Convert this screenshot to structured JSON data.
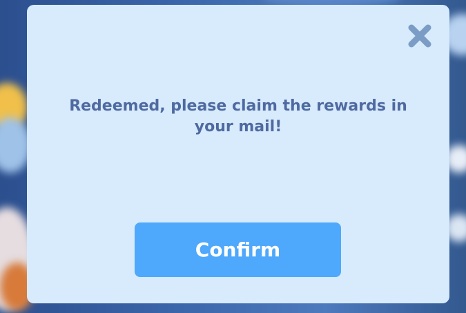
{
  "dialog": {
    "message": "Redeemed, please claim the rewards in your mail!",
    "confirm_label": "Confirm",
    "close_icon": "close-icon"
  },
  "colors": {
    "dialog_background": "#d7ebfd",
    "message_text": "#4f6aa0",
    "confirm_button": "#4ea8fb",
    "confirm_text": "#ffffff",
    "close_icon": "#7b9cc4"
  }
}
